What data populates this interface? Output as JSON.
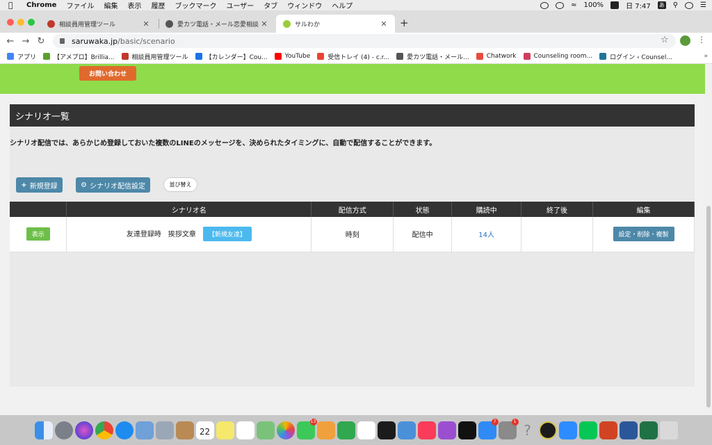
{
  "menubar": {
    "app_name": "Chrome",
    "menus": [
      "ファイル",
      "編集",
      "表示",
      "履歴",
      "ブックマーク",
      "ユーザー",
      "タブ",
      "ウィンドウ",
      "ヘルプ"
    ],
    "battery": "100%",
    "clock": "日 7:47",
    "ime": "あ"
  },
  "tabs": [
    {
      "label": "相談員用管理ツール",
      "active": false
    },
    {
      "label": "愛カツ電話・メール恋愛相談",
      "active": false
    },
    {
      "label": "サルわか",
      "active": true
    }
  ],
  "address_bar": {
    "host": "saruwaka.jp",
    "path": "/basic/scenario"
  },
  "bookmarks": [
    {
      "label": "アプリ",
      "color": "#4285f4"
    },
    {
      "label": "【アメプロ】Brillia...",
      "color": "#5aa02c"
    },
    {
      "label": "相談員用管理ツール",
      "color": "#c0392b"
    },
    {
      "label": "【カレンダー】Cou...",
      "color": "#1a73e8"
    },
    {
      "label": "YouTube",
      "color": "#ff0000"
    },
    {
      "label": "受信トレイ (4) - c.r...",
      "color": "#ea4335"
    },
    {
      "label": "愛カツ電話・メール...",
      "color": "#555555"
    },
    {
      "label": "Chatwork",
      "color": "#e94c3d"
    },
    {
      "label": "Counseling room...",
      "color": "#d13d5e"
    },
    {
      "label": "ログイン ‹ Counsel...",
      "color": "#21759b"
    }
  ],
  "page": {
    "contact_button": "お問い合わせ",
    "section_title": "シナリオ一覧",
    "description": "シナリオ配信では、あらかじめ登録しておいた複数のLINEのメッセージを、決められたタイミングに、自動で配信することができます。",
    "buttons": {
      "new_register": "新規登録",
      "scenario_settings": "シナリオ配信設定",
      "sort": "並び替え"
    },
    "table": {
      "columns": [
        "",
        "シナリオ名",
        "配信方式",
        "状態",
        "購読中",
        "終了後",
        "編集"
      ],
      "rows": [
        {
          "show": "表示",
          "name": "友達登録時　挨拶文章",
          "tag": "【新規友達】",
          "method": "時刻",
          "status": "配信中",
          "subscribers": "14人",
          "after_end": "",
          "edit": "設定・削除・複製"
        }
      ]
    }
  },
  "colors": {
    "banner_green": "#8fdb4a",
    "contact_orange": "#e06a2d",
    "header_dark": "#333333",
    "button_blue": "#4d88a8",
    "show_green": "#6dbf4a",
    "tag_blue": "#4cb9ee"
  },
  "dock": {
    "apps": [
      "finder-icon",
      "launchpad-icon",
      "siri-icon",
      "chrome-icon",
      "safari-icon",
      "preview-icon",
      "photo-icon",
      "notes-icon",
      "calendar-icon",
      "stickies-icon",
      "reminders-icon",
      "maps-icon",
      "photos-icon",
      "facetime-icon",
      "keynote-icon",
      "numbers-icon",
      "acrobat-icon",
      "acrobat2-icon",
      "keynote2-icon",
      "music-icon",
      "podcasts-icon",
      "appletv-icon",
      "appstore-icon",
      "system-preferences-icon",
      "help-icon",
      "unknown-icon",
      "zoom-icon",
      "line-icon",
      "powerpoint-icon",
      "word-icon",
      "excel-icon",
      "trash-icon"
    ],
    "calendar_day": "22",
    "badges": {
      "facetime": "13",
      "appstore": "7",
      "system-preferences": "1"
    }
  }
}
